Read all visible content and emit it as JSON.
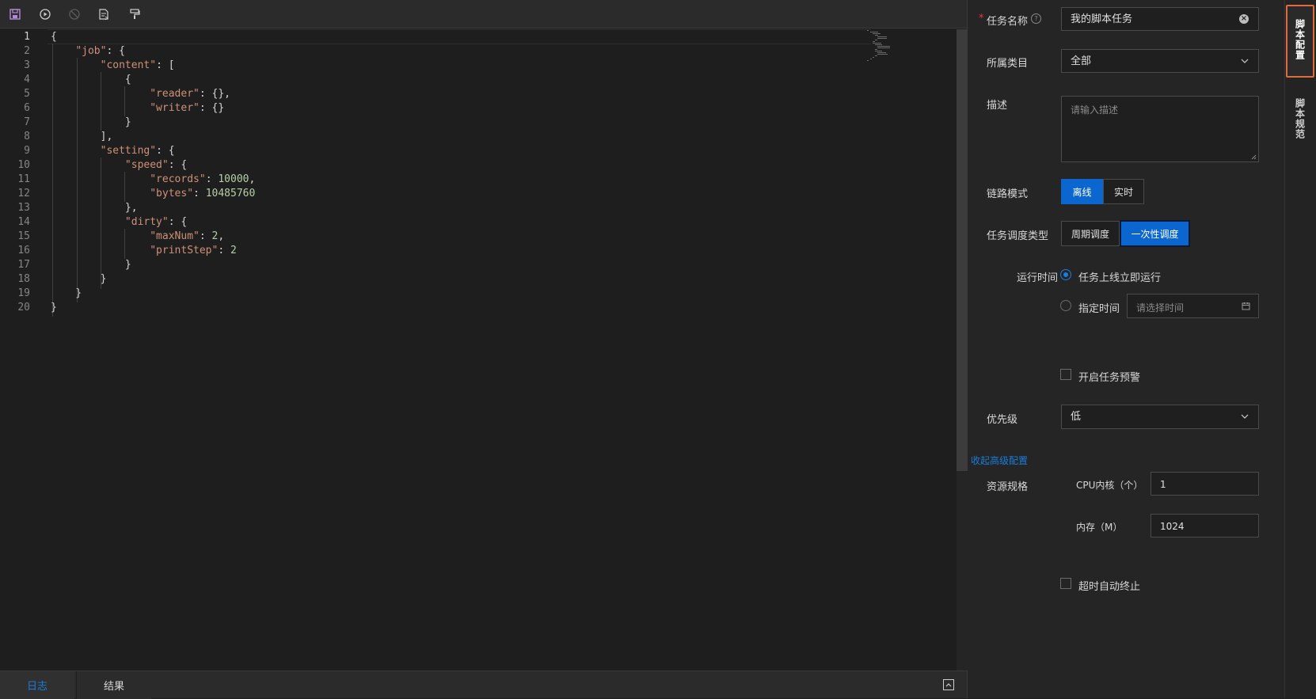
{
  "toolbar": {
    "buttons": [
      {
        "name": "save-icon"
      },
      {
        "name": "run-icon"
      },
      {
        "name": "stop-icon"
      },
      {
        "name": "format-document-icon"
      },
      {
        "name": "paint-roller-icon"
      }
    ]
  },
  "editor": {
    "lines": [
      {
        "n": "1",
        "text": "{"
      },
      {
        "n": "2",
        "text": "    \"job\": {"
      },
      {
        "n": "3",
        "text": "        \"content\": ["
      },
      {
        "n": "4",
        "text": "            {"
      },
      {
        "n": "5",
        "text": "                \"reader\": {},"
      },
      {
        "n": "6",
        "text": "                \"writer\": {}"
      },
      {
        "n": "7",
        "text": "            }"
      },
      {
        "n": "8",
        "text": "        ],"
      },
      {
        "n": "9",
        "text": "        \"setting\": {"
      },
      {
        "n": "10",
        "text": "            \"speed\": {"
      },
      {
        "n": "11",
        "text": "                \"records\": 10000,"
      },
      {
        "n": "12",
        "text": "                \"bytes\": 10485760"
      },
      {
        "n": "13",
        "text": "            },"
      },
      {
        "n": "14",
        "text": "            \"dirty\": {"
      },
      {
        "n": "15",
        "text": "                \"maxNum\": 2,"
      },
      {
        "n": "16",
        "text": "                \"printStep\": 2"
      },
      {
        "n": "17",
        "text": "            }"
      },
      {
        "n": "18",
        "text": "        }"
      },
      {
        "n": "19",
        "text": "    }"
      },
      {
        "n": "20",
        "text": "}"
      }
    ]
  },
  "bottom_tabs": {
    "log": "日志",
    "result": "结果"
  },
  "config": {
    "required_mark": "*",
    "task_name": {
      "label": "任务名称",
      "value": "我的脚本任务"
    },
    "category": {
      "label": "所属类目",
      "value": "全部"
    },
    "description": {
      "label": "描述",
      "placeholder": "请输入描述"
    },
    "link_mode": {
      "label": "链路模式",
      "options": [
        "离线",
        "实时"
      ],
      "selected": "离线"
    },
    "schedule_type": {
      "label": "任务调度类型",
      "options": [
        "周期调度",
        "一次性调度"
      ],
      "selected": "一次性调度"
    },
    "run_time": {
      "label": "运行时间",
      "option_now": "任务上线立即运行",
      "option_specific": "指定时间",
      "time_placeholder": "请选择时间",
      "selected": "任务上线立即运行"
    },
    "alert_checkbox": "开启任务预警",
    "priority": {
      "label": "优先级",
      "value": "低"
    },
    "collapse_link": "收起高级配置",
    "resources": {
      "label": "资源规格",
      "cpu_label": "CPU内核（个）",
      "cpu_value": "1",
      "mem_label": "内存（M）",
      "mem_value": "1024"
    },
    "timeout_checkbox": "超时自动终止"
  },
  "rail": {
    "tab_config": "脚本配置",
    "tab_spec": "脚本规范",
    "active": "脚本配置"
  },
  "colors": {
    "accent": "#0b66d0",
    "active_tab_border": "#e06b3c",
    "json_key": "#ce9178",
    "json_number": "#b5cea8"
  }
}
